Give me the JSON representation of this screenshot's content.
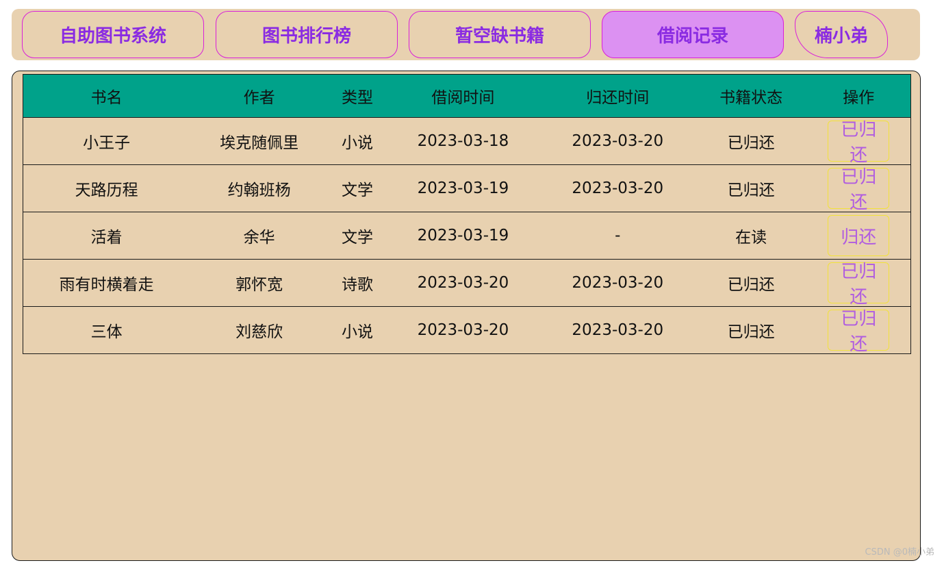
{
  "nav": {
    "items": [
      {
        "label": "自助图书系统"
      },
      {
        "label": "图书排行榜"
      },
      {
        "label": "暂空缺书籍"
      },
      {
        "label": "借阅记录"
      }
    ],
    "user_label": "楠小弟",
    "active_index": 3
  },
  "table": {
    "headers": [
      "书名",
      "作者",
      "类型",
      "借阅时间",
      "归还时间",
      "书籍状态",
      "操作"
    ],
    "rows": [
      {
        "title": "小王子",
        "author": "埃克随佩里",
        "type": "小说",
        "borrow": "2023-03-18",
        "return": "2023-03-20",
        "status": "已归还",
        "action": "已归还"
      },
      {
        "title": "天路历程",
        "author": "约翰班杨",
        "type": "文学",
        "borrow": "2023-03-19",
        "return": "2023-03-20",
        "status": "已归还",
        "action": "已归还"
      },
      {
        "title": "活着",
        "author": "余华",
        "type": "文学",
        "borrow": "2023-03-19",
        "return": "-",
        "status": "在读",
        "action": "归还"
      },
      {
        "title": "雨有时横着走",
        "author": "郭怀宽",
        "type": "诗歌",
        "borrow": "2023-03-20",
        "return": "2023-03-20",
        "status": "已归还",
        "action": "已归还"
      },
      {
        "title": "三体",
        "author": "刘慈欣",
        "type": "小说",
        "borrow": "2023-03-20",
        "return": "2023-03-20",
        "status": "已归还",
        "action": "已归还"
      }
    ]
  },
  "watermark": "CSDN @0楠小弟",
  "colors": {
    "panel_bg": "#e8d1b0",
    "header_bg": "#00a28a",
    "nav_text": "#8a2be2",
    "nav_border": "#d91fd9",
    "nav_active_bg": "#dc91f2",
    "action_text": "#b05ce0",
    "action_border": "#f2e23a"
  }
}
